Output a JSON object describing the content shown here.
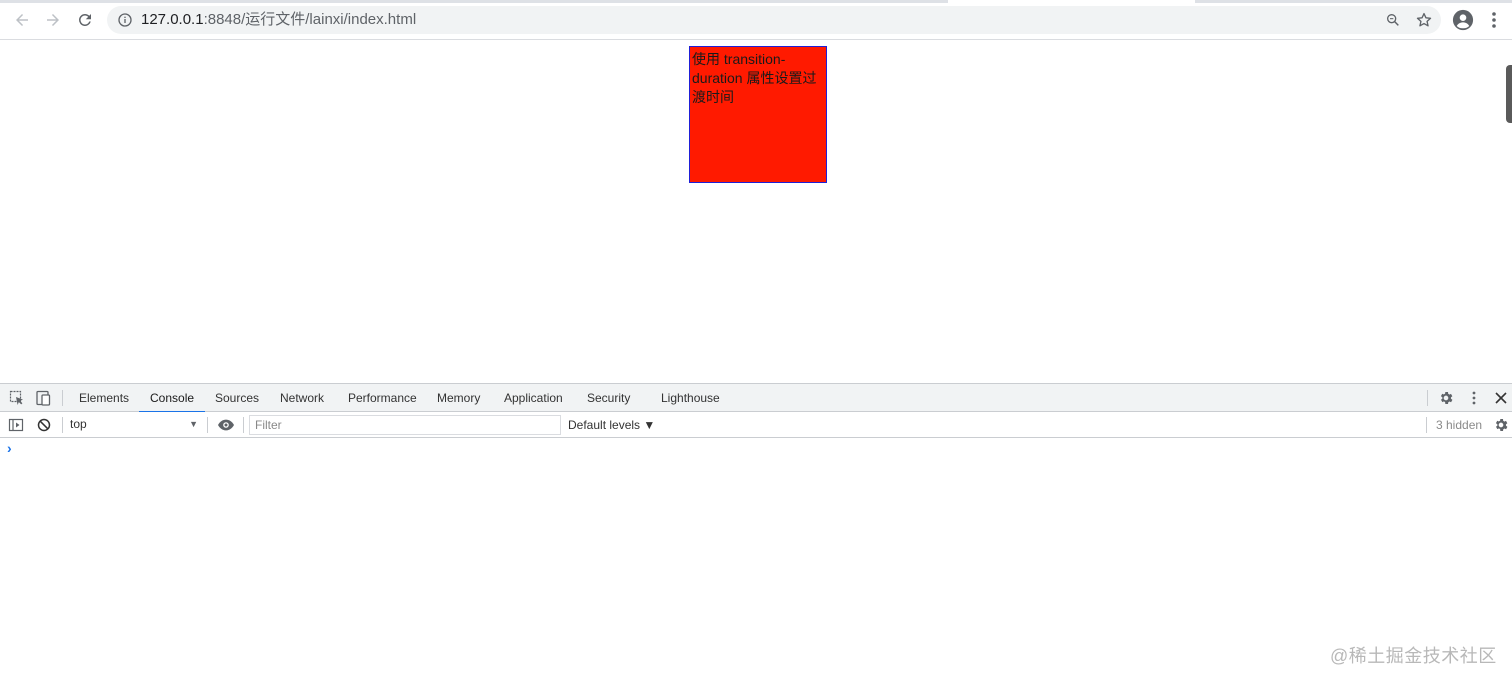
{
  "browser": {
    "url_host": "127.0.0.1",
    "url_path": ":8848/运行文件/lainxi/index.html",
    "icons": {
      "back": "back-arrow-icon",
      "forward": "forward-arrow-icon",
      "reload": "reload-icon",
      "site_info": "info-icon",
      "zoom": "zoom-magnifier-icon",
      "bookmark": "star-icon",
      "profile": "profile-icon",
      "menu": "kebab-menu-icon"
    }
  },
  "page": {
    "demo_text": "使用 transition-duration 属性设置过渡时间",
    "demo_box_color": "#ff1a00",
    "demo_box_border_color": "#1f1fd6"
  },
  "devtools": {
    "tabs": [
      {
        "label": "Elements",
        "active": false
      },
      {
        "label": "Console",
        "active": true
      },
      {
        "label": "Sources",
        "active": false
      },
      {
        "label": "Network",
        "active": false
      },
      {
        "label": "Performance",
        "active": false
      },
      {
        "label": "Memory",
        "active": false
      },
      {
        "label": "Application",
        "active": false
      },
      {
        "label": "Security",
        "active": false
      },
      {
        "label": "Lighthouse",
        "active": false
      }
    ],
    "accent_color": "#1a73e8",
    "toolbar": {
      "context": "top",
      "filter_placeholder": "Filter",
      "levels": "Default levels ▼",
      "hidden": "3 hidden"
    },
    "prompt": "›"
  },
  "watermark": "@稀土掘金技术社区"
}
